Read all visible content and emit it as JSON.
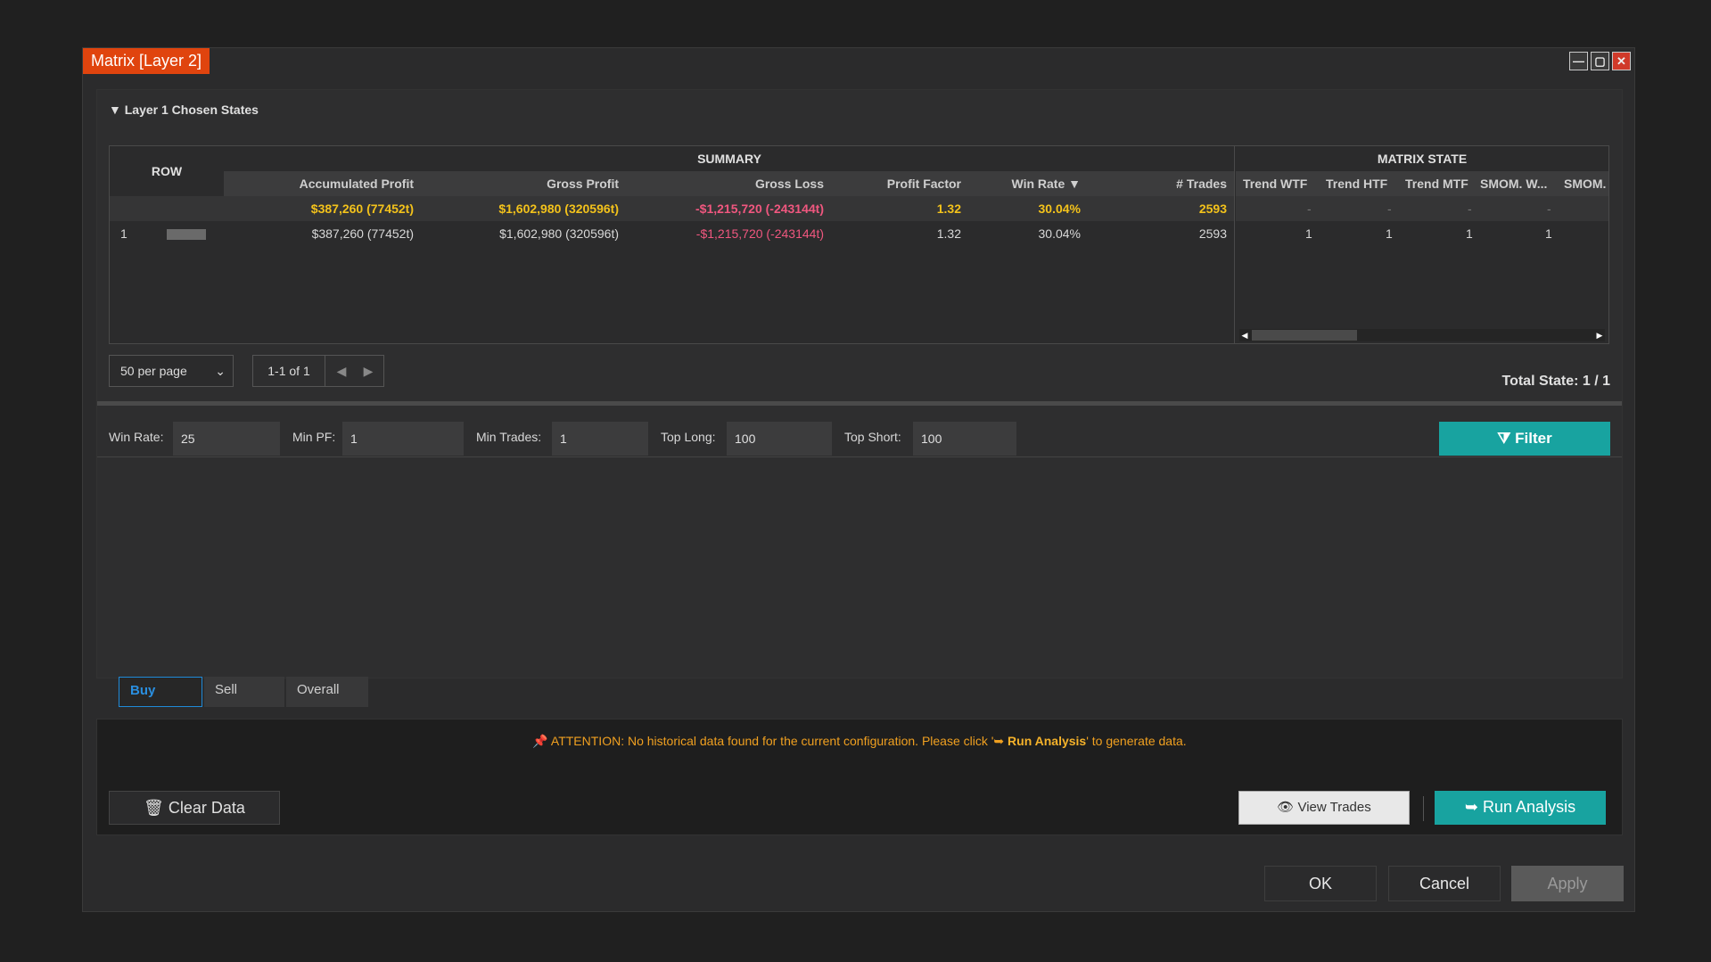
{
  "window": {
    "title": "Matrix [Layer 2]",
    "controls": {
      "minimize": "—",
      "maximize": "▢",
      "close": "✕"
    }
  },
  "section": {
    "arrow": "▼",
    "title": "Layer 1 Chosen States"
  },
  "table": {
    "group_summary": "SUMMARY",
    "group_matrix": "MATRIX STATE",
    "row_header": "ROW",
    "columns": [
      "Accumulated Profit",
      "Gross Profit",
      "Gross Loss",
      "Profit Factor",
      "Win Rate ▼",
      "# Trades"
    ],
    "matrix_columns": [
      "Trend WTF",
      "Trend HTF",
      "Trend MTF",
      "SMOM. W...",
      "SMOM."
    ],
    "summary_row": {
      "accumulated_profit": "$387,260 (77452t)",
      "gross_profit": "$1,602,980 (320596t)",
      "gross_loss": "-$1,215,720 (-243144t)",
      "profit_factor": "1.32",
      "win_rate": "30.04%",
      "trades": "2593",
      "matrix": [
        "-",
        "-",
        "-",
        "-"
      ]
    },
    "rows": [
      {
        "row": "1",
        "accumulated_profit": "$387,260 (77452t)",
        "gross_profit": "$1,602,980 (320596t)",
        "gross_loss": "-$1,215,720 (-243144t)",
        "profit_factor": "1.32",
        "win_rate": "30.04%",
        "trades": "2593",
        "matrix": [
          "1",
          "1",
          "1",
          "1"
        ]
      }
    ]
  },
  "pagination": {
    "per_page": "50 per page",
    "range": "1-1 of 1",
    "prev": "◀",
    "next": "▶"
  },
  "total_state": "Total State: 1 / 1",
  "filters": {
    "win_rate": {
      "label": "Win Rate:",
      "value": "25"
    },
    "min_pf": {
      "label": "Min PF:",
      "value": "1"
    },
    "min_trades": {
      "label": "Min Trades:",
      "value": "1"
    },
    "top_long": {
      "label": "Top Long:",
      "value": "100"
    },
    "top_short": {
      "label": "Top Short:",
      "value": "100"
    },
    "filter_button": "Filter"
  },
  "tabs": [
    "Buy",
    "Sell",
    "Overall"
  ],
  "attention": {
    "prefix": "ATTENTION: No historical data found for the current configuration. Please click '",
    "action": "Run Analysis",
    "suffix": "' to generate data."
  },
  "buttons": {
    "clear": "Clear Data",
    "view_trades": "View Trades",
    "run_analysis": "Run Analysis",
    "ok": "OK",
    "cancel": "Cancel",
    "apply": "Apply"
  },
  "colors": {
    "accent_orange": "#e0440e",
    "teal": "#18a3a0",
    "yellow": "#f3c21b",
    "pink": "#f0577f",
    "tab_blue": "#2a8fe0"
  }
}
